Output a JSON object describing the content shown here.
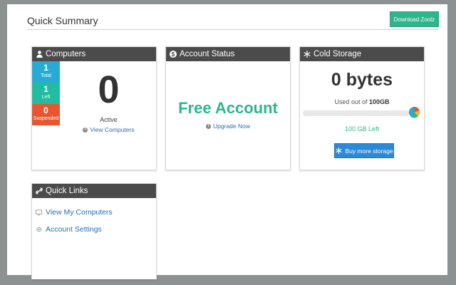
{
  "page": {
    "title": "Quick Summary",
    "download_label": "Download Zoolz"
  },
  "computers": {
    "title": "Computers",
    "stats": [
      {
        "value": "1",
        "label": "Total",
        "color": "#27abd4"
      },
      {
        "value": "1",
        "label": "Left",
        "color": "#22bca0"
      },
      {
        "value": "0",
        "label": "Suspended",
        "color": "#e85631"
      }
    ],
    "active_count": "0",
    "active_label": "Active",
    "view_link": "View Computers",
    "icon": "user-icon"
  },
  "account": {
    "title": "Account Status",
    "status": "Free Account",
    "upgrade_link": "Upgrade Now",
    "icon": "dollar-icon"
  },
  "storage": {
    "title": "Cold Storage",
    "amount": "0 bytes",
    "used_prefix": "Used out of",
    "used_total": "100GB",
    "used_fraction": 0,
    "left_label": "100 GB Left",
    "buy_label": "Buy more storage",
    "icon": "snowflake-icon"
  },
  "quick_links": {
    "title": "Quick Links",
    "icon": "link-icon",
    "items": [
      {
        "label": "View My Computers",
        "icon": "monitor-icon"
      },
      {
        "label": "Account Settings",
        "icon": "gear-icon"
      }
    ]
  },
  "colors": {
    "accent_green": "#2fb58c",
    "header_dark": "#4b4b4b",
    "link_blue": "#2a6fb0",
    "button_blue": "#2b8ad6"
  }
}
